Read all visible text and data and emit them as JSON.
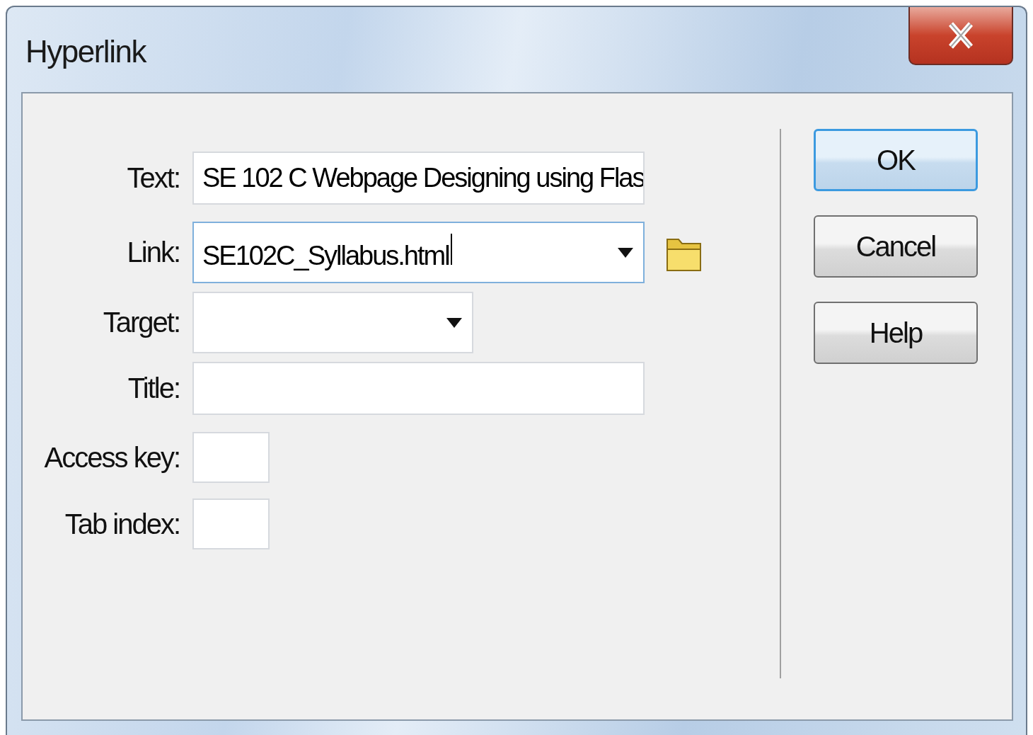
{
  "window": {
    "title": "Hyperlink"
  },
  "fields": [
    {
      "label": "Text:",
      "kind": "text",
      "value": "SE 102 C Webpage Designing using Flas",
      "focused": false,
      "browse": false
    },
    {
      "label": "Link:",
      "kind": "combo",
      "value": "SE102C_Syllabus.html",
      "focused": true,
      "browse": true
    },
    {
      "label": "Target:",
      "kind": "combo",
      "focused": false,
      "browse": false
    },
    {
      "label": "Title:",
      "kind": "text",
      "focused": false,
      "browse": false
    },
    {
      "label": "Access key:",
      "kind": "key",
      "focused": false,
      "browse": false
    },
    {
      "label": "Tab index:",
      "kind": "key",
      "focused": false,
      "browse": false
    }
  ],
  "buttons": [
    {
      "label": "OK",
      "default": true
    },
    {
      "label": "Cancel",
      "default": false
    },
    {
      "label": "Help",
      "default": false
    }
  ]
}
